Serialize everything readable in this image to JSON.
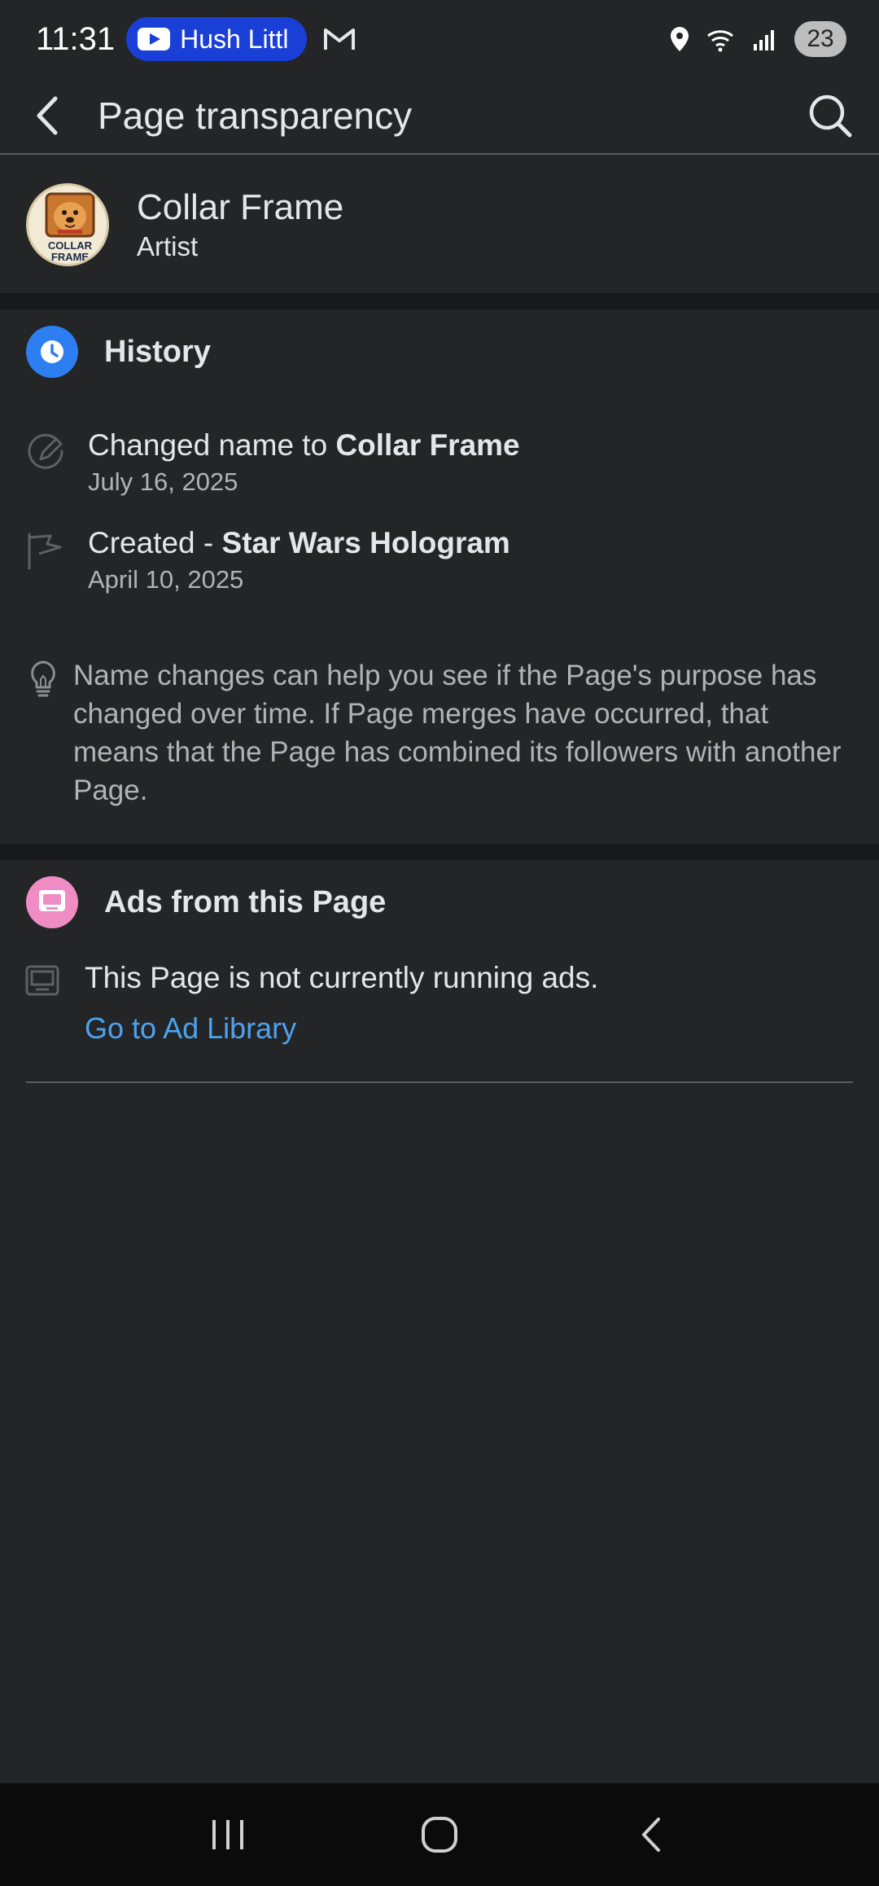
{
  "status_bar": {
    "time": "11:31",
    "media_pill_text": "Hush Littl",
    "battery": "23"
  },
  "app_bar": {
    "title": "Page transparency"
  },
  "profile": {
    "name": "Collar Frame",
    "category": "Artist",
    "avatar_text_line1": "COLLAR",
    "avatar_text_line2": "FRAME"
  },
  "history": {
    "title": "History",
    "items": [
      {
        "prefix": "Changed name to ",
        "bold": "Collar Frame",
        "date": "July 16, 2025",
        "icon": "pencil-icon"
      },
      {
        "prefix": "Created - ",
        "bold": "Star Wars Hologram",
        "date": "April 10, 2025",
        "icon": "flag-icon"
      }
    ],
    "note": "Name changes can help you see if the Page's purpose has changed over time. If Page merges have occurred, that means that the Page has combined its followers with another Page."
  },
  "ads": {
    "title": "Ads from this Page",
    "status": "This Page is not currently running ads.",
    "link": "Go to Ad Library"
  },
  "colors": {
    "background": "#242526",
    "separator": "#18191a",
    "history_icon_bg": "#2d7ef0",
    "ads_icon_bg": "#f08cc4",
    "link": "#4da3f0"
  }
}
